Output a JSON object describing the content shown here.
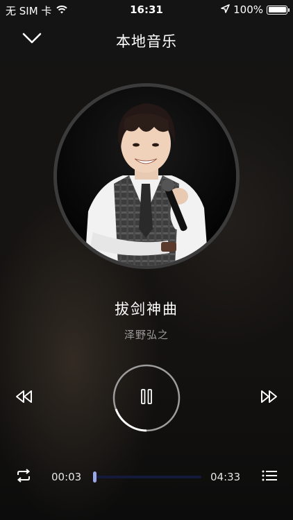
{
  "status_bar": {
    "carrier": "无 SIM 卡",
    "time": "16:31",
    "battery": "100%",
    "icons": [
      "wifi-icon",
      "location-arrow-icon",
      "battery-icon"
    ]
  },
  "nav": {
    "back_icon": "chevron-down-icon",
    "title": "本地音乐"
  },
  "song": {
    "title": "拔剑神曲",
    "artist": "泽野弘之"
  },
  "player": {
    "state": "playing",
    "current_time": "00:03",
    "total_time": "04:33",
    "progress_fraction": 0.011,
    "controls": [
      "previous-icon",
      "pause-icon",
      "next-icon",
      "repeat-icon",
      "playlist-icon"
    ]
  },
  "colors": {
    "background": "#141414",
    "accent": "#9aa8e8",
    "track": "#141b3a",
    "artist_text": "#9a9a9a"
  }
}
